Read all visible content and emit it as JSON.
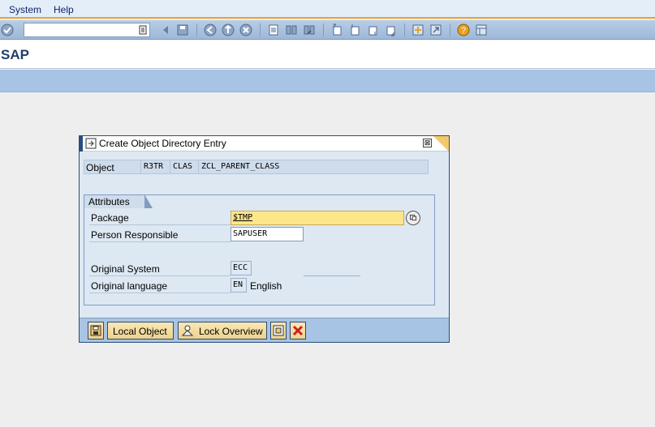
{
  "menu": {
    "items": [
      {
        "label": "System"
      },
      {
        "label": "Help"
      }
    ]
  },
  "toolbar": {
    "command_value": "",
    "icons": [
      "enter-icon",
      "history-icon",
      "back-icon",
      "save-icon",
      "back-arrow-icon",
      "exit-icon",
      "cancel-icon",
      "print-icon",
      "find-icon",
      "find-next-icon",
      "first-page-icon",
      "previous-page-icon",
      "next-page-icon",
      "last-page-icon",
      "new-session-icon",
      "shortcut-icon",
      "help-icon",
      "layout-icon"
    ]
  },
  "title": "SAP",
  "dialog": {
    "title": "Create Object Directory Entry",
    "close_symbol": "⊠",
    "object": {
      "label": "Object",
      "pgmid": "R3TR",
      "type": "CLAS",
      "name": "ZCL_PARENT_CLASS"
    },
    "attributes": {
      "group_label": "Attributes",
      "package_label": "Package",
      "package_value_prefix": "$",
      "package_value_rest": "TMP",
      "person_label": "Person Responsible",
      "person_value": "SAPUSER",
      "orig_system_label": "Original System",
      "orig_system_value": "ECC",
      "orig_language_label": "Original language",
      "orig_language_code": "EN",
      "orig_language_text": "English"
    },
    "buttons": {
      "local_object": "Local Object",
      "lock_overview": "Lock Overview"
    }
  },
  "colors": {
    "menu_accent": "#f0a030",
    "toolbar_blue": "#a8c4e4",
    "dialog_frame": "#284e7d",
    "required_field": "#fde68a",
    "button_fill": "#eed38e",
    "cancel_red": "#cc2020"
  }
}
